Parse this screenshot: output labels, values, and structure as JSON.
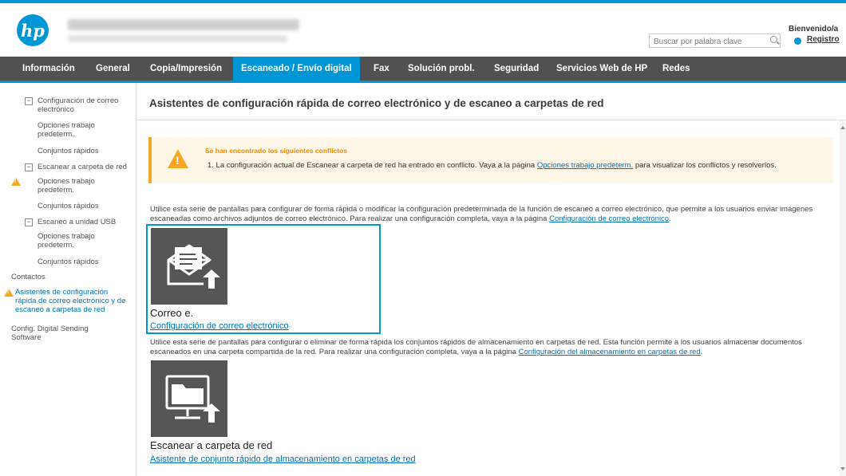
{
  "header": {
    "logo_text": "hp",
    "search_placeholder": "Buscar por palabra clave",
    "welcome": "Bienvenido/a",
    "register_link": "Registro"
  },
  "nav": {
    "tabs": [
      {
        "label": "Información"
      },
      {
        "label": "General"
      },
      {
        "label": "Copia/Impresión"
      },
      {
        "label": "Escaneado / Envío digital",
        "active": true
      },
      {
        "label": "Fax"
      },
      {
        "label": "Solución probl."
      },
      {
        "label": "Seguridad"
      },
      {
        "label": "Servicios Web de HP"
      },
      {
        "label": "Redes"
      }
    ]
  },
  "sidebar": {
    "items": [
      {
        "label": "Configuración de correo electrónico",
        "toggle": "−"
      },
      {
        "label": "Opciones trabajo predeterm."
      },
      {
        "label": "Conjuntos rápidos"
      },
      {
        "label": "Escanear a carpeta de red",
        "toggle": "−"
      },
      {
        "label": "Opciones trabajo predeterm.",
        "warning": true
      },
      {
        "label": "Conjuntos rápidos"
      },
      {
        "label": "Escaneo a unidad USB",
        "toggle": "−"
      },
      {
        "label": "Opciones trabajo predeterm."
      },
      {
        "label": "Conjuntos rápidos"
      },
      {
        "label": "Contactos"
      },
      {
        "label": "Asistentes de configuración rápida de correo electrónico y de escaneo a carpetas de red",
        "warning": true,
        "selected": true
      },
      {
        "label": "Config. Digital Sending Software"
      }
    ]
  },
  "main": {
    "title": "Asistentes de configuración rápida de correo electrónico y de escaneo a carpetas de red",
    "alert": {
      "heading": "Se han encontrado los siguientes conflictos",
      "message_prefix": "1.  La configuración actual de Escanear a carpeta de red ha entrado en conflicto. Vaya a la página ",
      "message_link": "Opciones trabajo predeterm.",
      "message_suffix": " para visualizar los conflictos y resolverlos."
    },
    "email_intro": {
      "text": "Utilice esta serie de pantallas para configurar de forma rápida o modificar la configuración predeterminada de la función de escaneo a correo electrónico, que permite a los usuarios enviar imágenes escaneadas como archivos adjuntos de correo electrónico. Para realizar una configuración completa, vaya a la página ",
      "link": "Configuración de correo electrónico",
      "suffix": "."
    },
    "email_card": {
      "title": "Correo e.",
      "link": "Configuración de correo electrónico"
    },
    "folder_intro": {
      "text": "Utilice esta serie de pantallas para configurar o eliminar de forma rápida los conjuntos rápidos de almacenamiento en carpetas de red. Esta función permite a los usuarios almacenar documentos escaneados en una carpeta compartida de la red. Para realizar una configuración completa, vaya a la página ",
      "link": "Configuración del almacenamiento en carpetas de red",
      "suffix": "."
    },
    "folder_card": {
      "title": "Escanear a carpeta de red",
      "link": "Asistente de conjunto rápido de almacenamiento en carpetas de red"
    }
  },
  "colors": {
    "accent": "#0096d6",
    "nav_bg": "#515151",
    "warning": "#f5a623",
    "link": "#0073b7",
    "tile_bg": "#555555"
  }
}
